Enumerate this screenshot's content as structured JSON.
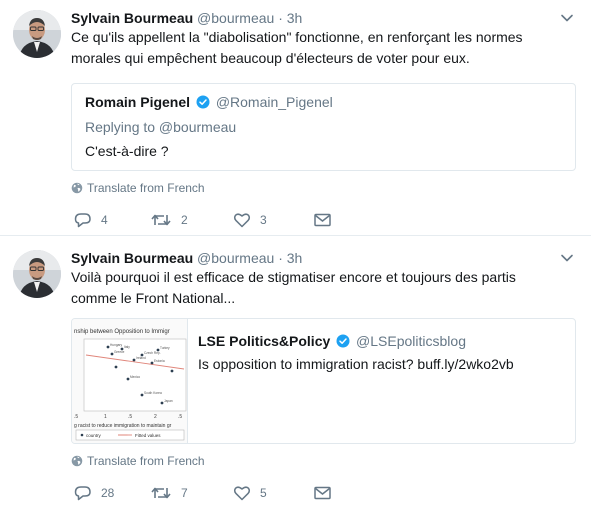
{
  "tweets": [
    {
      "author": {
        "name": "Sylvain Bourmeau",
        "handle": "@bourmeau"
      },
      "separator": "·",
      "time": "3h",
      "text_lines": [
        "Ce qu'ils appellent la \"diabolisation\" fonctionne, en renforçant les normes",
        "morales qui empêchent beaucoup d'électeurs de voter pour eux."
      ],
      "quoted": {
        "name": "Romain Pigenel",
        "handle": "@Romain_Pigenel",
        "replying_to": "Replying to @bourmeau",
        "text": "C'est-à-dire ?"
      },
      "translate_label": "Translate from French",
      "counts": {
        "replies": "4",
        "retweets": "2",
        "likes": "3"
      }
    },
    {
      "author": {
        "name": "Sylvain Bourmeau",
        "handle": "@bourmeau"
      },
      "separator": "·",
      "time": "3h",
      "text_lines": [
        "Voilà pourquoi il est efficace de stigmatiser encore et toujours des partis",
        "comme le Front National..."
      ],
      "card": {
        "name": "LSE Politics&Policy",
        "handle": "@LSEpoliticsblog",
        "text": "Is opposition to immigration racist? buff.ly/2wko2vb",
        "thumb_title": "nship between Opposition to Immigr",
        "thumb_xlabel": "g racist to reduce immigration to maintain gr",
        "thumb_ticks": [
          ".5",
          "1",
          ".5",
          "2",
          ".5"
        ],
        "thumb_legend": [
          "country",
          "Fitted values"
        ],
        "thumb_points": [
          "Hungary",
          "Italy",
          "Turkey",
          "Greece",
          "Czech Rep.",
          "Ireland",
          "Estonia",
          "Mexico",
          "South Korea",
          "Japan"
        ]
      },
      "translate_label": "Translate from French",
      "counts": {
        "replies": "28",
        "retweets": "7",
        "likes": "5"
      }
    }
  ],
  "colors": {
    "text": "#14171a",
    "secondary": "#657786",
    "border": "#e1e8ed",
    "verified": "#1da1f2"
  },
  "icons": [
    "chevron-down-icon",
    "verified-badge-icon",
    "globe-icon",
    "reply-icon",
    "retweet-icon",
    "heart-icon",
    "envelope-icon"
  ]
}
